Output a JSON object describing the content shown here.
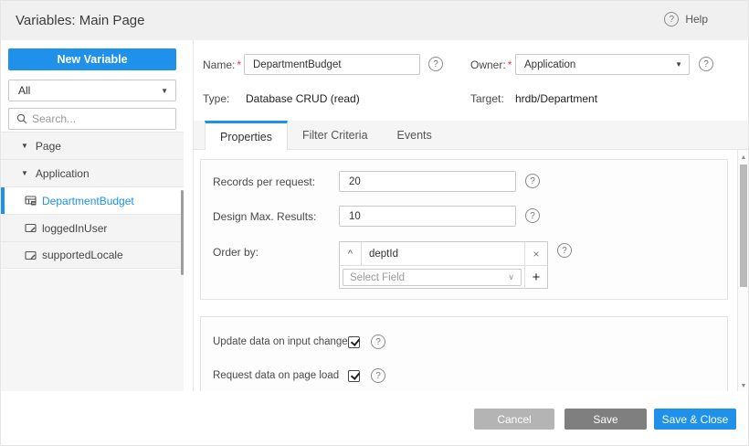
{
  "header": {
    "title": "Variables: Main Page",
    "help_label": "Help"
  },
  "sidebar": {
    "new_variable_label": "New Variable",
    "filter_value": "All",
    "search_placeholder": "Search...",
    "tree": [
      {
        "label": "Page",
        "type": "group",
        "expanded": true
      },
      {
        "label": "Application",
        "type": "group",
        "expanded": true
      },
      {
        "label": "DepartmentBudget",
        "type": "variable",
        "selected": true
      },
      {
        "label": "loggedInUser",
        "type": "variable",
        "selected": false
      },
      {
        "label": "supportedLocale",
        "type": "variable",
        "selected": false
      }
    ]
  },
  "meta": {
    "name_label": "Name:",
    "name_value": "DepartmentBudget",
    "owner_label": "Owner:",
    "owner_value": "Application",
    "type_label": "Type:",
    "type_value": "Database CRUD (read)",
    "target_label": "Target:",
    "target_value": "hrdb/Department",
    "required_marker": "*"
  },
  "tabs": [
    {
      "label": "Properties",
      "active": true
    },
    {
      "label": "Filter Criteria",
      "active": false
    },
    {
      "label": "Events",
      "active": false
    }
  ],
  "properties": {
    "records_label": "Records per request:",
    "records_value": "20",
    "max_results_label": "Design Max. Results:",
    "max_results_value": "10",
    "orderby_label": "Order by:",
    "orderby_field_value": "deptId",
    "select_field_placeholder": "Select Field",
    "update_on_change_label": "Update data on input change",
    "update_on_change_checked": true,
    "request_on_load_label": "Request data on page load",
    "request_on_load_checked": true
  },
  "footer": {
    "cancel_label": "Cancel",
    "save_label": "Save",
    "save_close_label": "Save & Close"
  },
  "icons": {
    "question": "?",
    "caret_down": "▼",
    "chevron_down": "∨",
    "sort_asc": "^",
    "remove": "×",
    "add": "+",
    "scroll_up": "▲",
    "scroll_down": "▼"
  },
  "colors": {
    "accent_blue": "#2091ea",
    "header_bg": "#f0f0f1",
    "cancel_button": "#b4b4b4",
    "save_button": "#7f7f7f",
    "required_red": "#e53935",
    "selected_text": "#2091ea"
  }
}
